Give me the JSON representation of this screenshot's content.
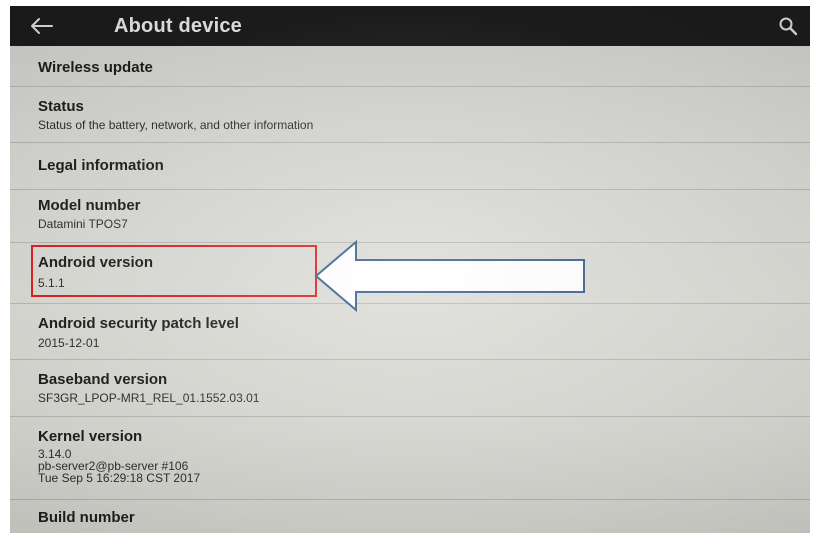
{
  "appbar": {
    "title": "About device",
    "back_icon": "arrow-left-icon",
    "search_icon": "search-icon"
  },
  "items": [
    {
      "title": "Wireless update"
    },
    {
      "title": "Status",
      "summary": "Status of the battery, network, and other information"
    },
    {
      "title": "Legal information"
    },
    {
      "title": "Model number",
      "summary": "Datamini TPOS7"
    },
    {
      "title": "Android version",
      "summary": "5.1.1"
    },
    {
      "title": "Android security patch level",
      "summary": "2015-12-01"
    },
    {
      "title": "Baseband version",
      "summary": "SF3GR_LPOP-MR1_REL_01.1552.03.01"
    },
    {
      "title": "Kernel version",
      "summary_lines": [
        "3.14.0",
        "pb-server2@pb-server #106",
        "Tue Sep 5 16:29:18 CST 2017"
      ]
    },
    {
      "title": "Build number"
    }
  ],
  "annotation": {
    "highlight_color": "#e02020",
    "arrow_fill": "#ffffff",
    "arrow_stroke": "#3a5f8c"
  }
}
